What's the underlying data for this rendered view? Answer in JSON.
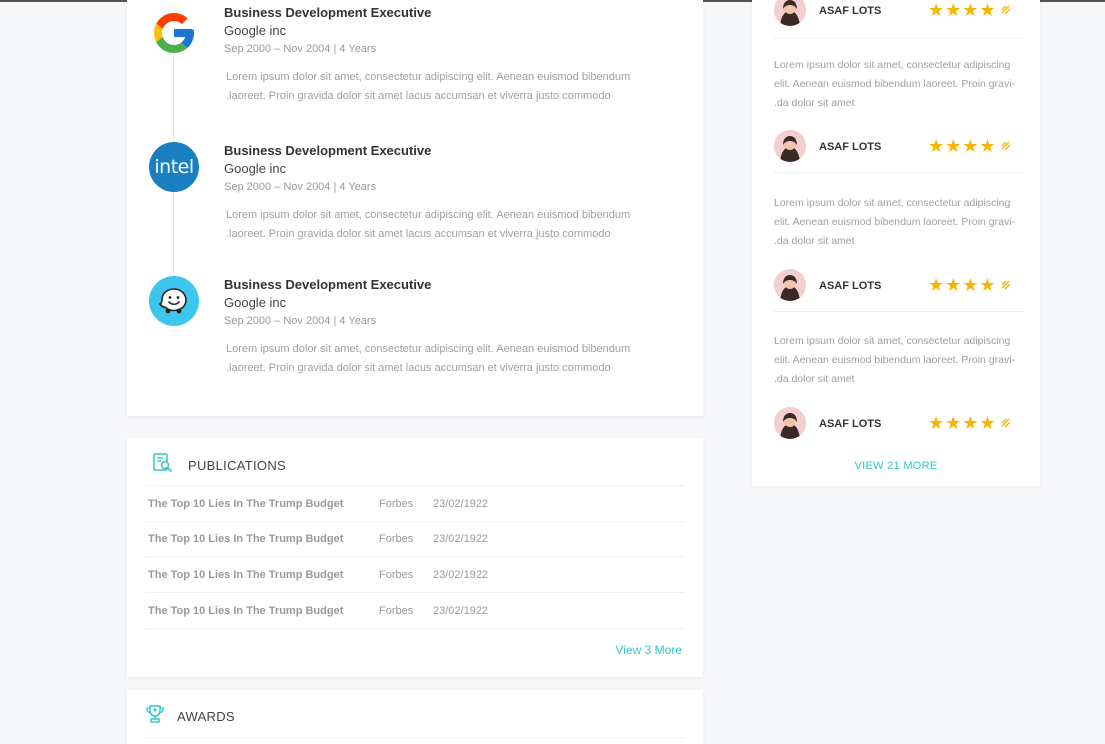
{
  "experience": {
    "items": [
      {
        "logo": "google-logo",
        "title": "Business Development Executive",
        "company": "Google inc",
        "dates": "Sep 2000 – Nov 2004 | 4 Years",
        "desc_line1": "Lorem ipsum dolor sit amet, consectetur adipiscing elit. Aenean euismod bibendum",
        "desc_line2": ".laoreet. Proin gravida dolor sit amet lacus accumsan et viverra justo commodo"
      },
      {
        "logo": "intel-logo",
        "logo_text": "intel",
        "title": "Business Development Executive",
        "company": "Google inc",
        "dates": "Sep 2000 – Nov 2004 | 4 Years",
        "desc_line1": "Lorem ipsum dolor sit amet, consectetur adipiscing elit. Aenean euismod bibendum",
        "desc_line2": ".laoreet. Proin gravida dolor sit amet lacus accumsan et viverra justo commodo"
      },
      {
        "logo": "waze-logo",
        "title": "Business Development Executive",
        "company": "Google inc",
        "dates": "Sep 2000 – Nov 2004 | 4 Years",
        "desc_line1": "Lorem ipsum dolor sit amet, consectetur adipiscing elit. Aenean euismod bibendum",
        "desc_line2": ".laoreet. Proin gravida dolor sit amet lacus accumsan et viverra justo commodo"
      }
    ]
  },
  "publications": {
    "title": "PUBLICATIONS",
    "icon": "publication-search-icon",
    "rows": [
      {
        "title": "The Top 10 Lies In The Trump Budget",
        "source": "Forbes",
        "date": "23/02/1922"
      },
      {
        "title": "The Top 10 Lies In The Trump Budget",
        "source": "Forbes",
        "date": "23/02/1922"
      },
      {
        "title": "The Top 10 Lies In The Trump Budget",
        "source": "Forbes",
        "date": "23/02/1922"
      },
      {
        "title": "The Top 10 Lies In The Trump Budget",
        "source": "Forbes",
        "date": "23/02/1922"
      }
    ],
    "view_more": "View 3 More"
  },
  "awards": {
    "title": "AWARDS",
    "icon": "trophy-icon"
  },
  "reviews": {
    "items": [
      {
        "name": "ASAF LOTS",
        "rating": 4.5
      },
      {
        "desc_line1": "Lorem ipsum dolor sit amet, consectetur adipiscing",
        "desc_line2": "elit. Aenean euismod bibendum laoreet. Proin gravi-",
        "desc_line3": ".da dolor sit amet",
        "name": "ASAF LOTS",
        "rating": 4.5
      },
      {
        "desc_line1": "Lorem ipsum dolor sit amet, consectetur adipiscing",
        "desc_line2": "elit. Aenean euismod bibendum laoreet. Proin gravi-",
        "desc_line3": ".da dolor sit amet",
        "name": "ASAF LOTS",
        "rating": 4.5
      },
      {
        "desc_line1": "Lorem ipsum dolor sit amet, consectetur adipiscing",
        "desc_line2": "elit. Aenean euismod bibendum laoreet. Proin gravi-",
        "desc_line3": ".da dolor sit amet",
        "name": "ASAF LOTS",
        "rating": 4.5
      }
    ],
    "view_more": "VIEW 21 MORE"
  },
  "colors": {
    "accent": "#32c6c6",
    "star": "#f7b500",
    "background": "#f6f7f9"
  }
}
